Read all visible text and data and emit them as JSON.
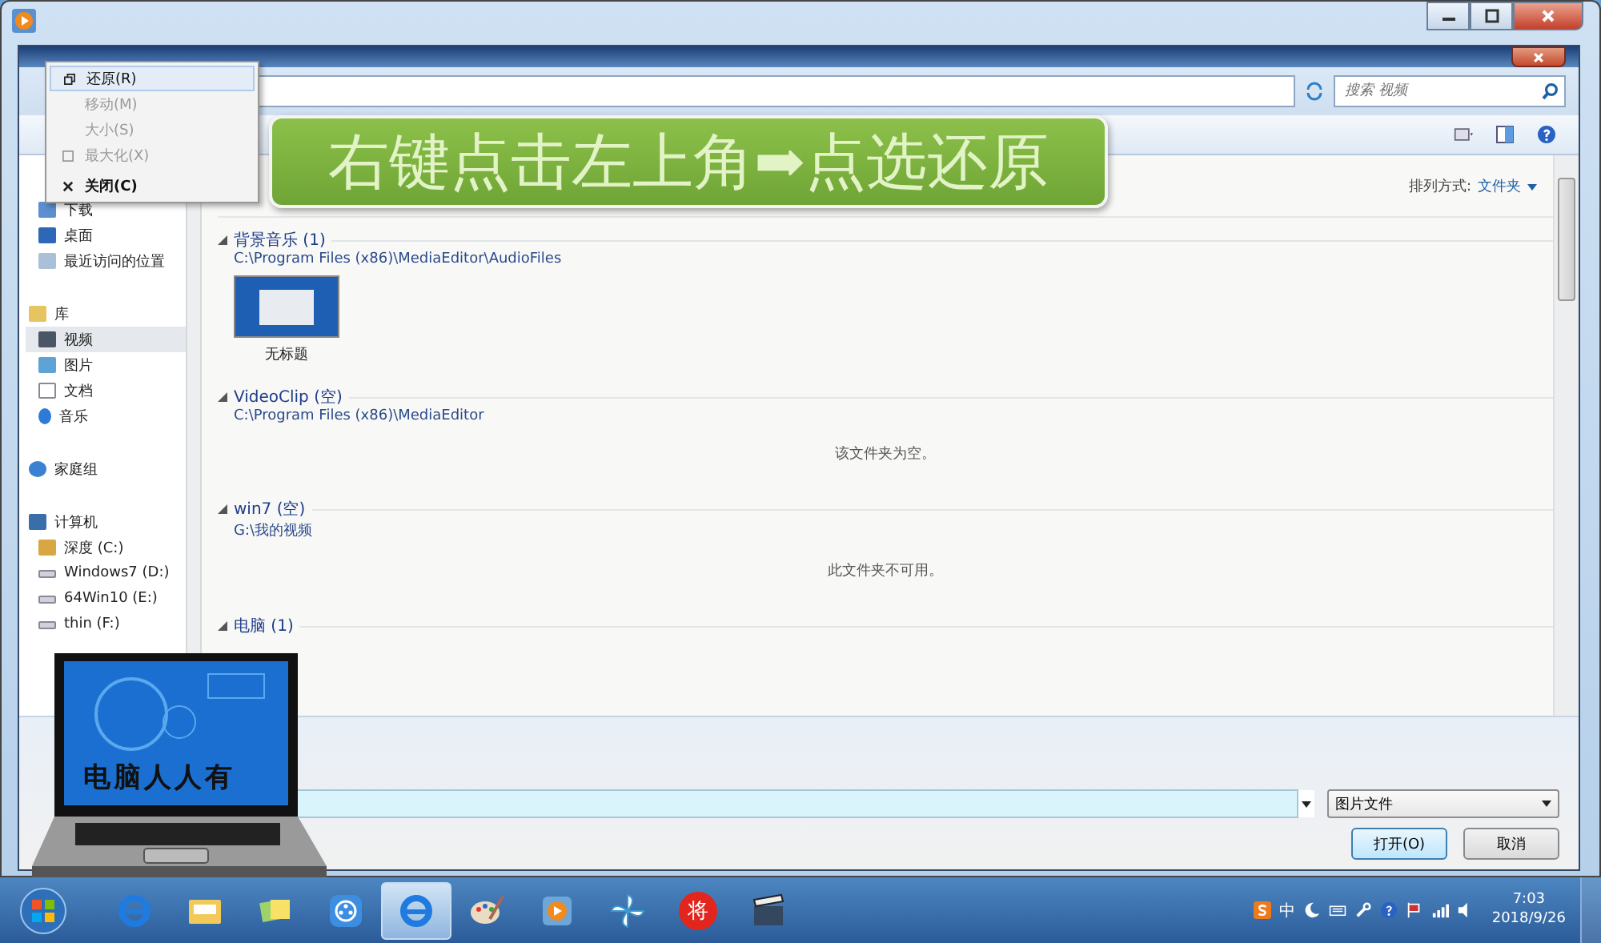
{
  "context_menu": {
    "items": [
      {
        "label": "还原(R)",
        "disabled": false,
        "selected": true,
        "bold": false,
        "kind": "restore"
      },
      {
        "label": "移动(M)",
        "disabled": true,
        "selected": false,
        "bold": false,
        "kind": "none"
      },
      {
        "label": "大小(S)",
        "disabled": true,
        "selected": false,
        "bold": false,
        "kind": "none"
      },
      {
        "label": "最大化(X)",
        "disabled": true,
        "selected": false,
        "bold": false,
        "kind": "maximize"
      },
      {
        "label": "关闭(C)",
        "disabled": false,
        "selected": false,
        "bold": true,
        "kind": "close"
      }
    ]
  },
  "callout": {
    "text": "右键点击左上角➡点选还原"
  },
  "search": {
    "placeholder": "搜索 视频"
  },
  "sort": {
    "label": "排列方式:",
    "value": "文件夹"
  },
  "sidebar": {
    "items": [
      {
        "label": "下载",
        "kind": "download",
        "selected": false
      },
      {
        "label": "桌面",
        "kind": "desktop",
        "selected": false
      },
      {
        "label": "最近访问的位置",
        "kind": "recent",
        "selected": false
      },
      {
        "label": "库",
        "kind": "library",
        "selected": false,
        "children": [
          {
            "label": "视频",
            "kind": "video",
            "selected": true
          },
          {
            "label": "图片",
            "kind": "picture",
            "selected": false
          },
          {
            "label": "文档",
            "kind": "document",
            "selected": false
          },
          {
            "label": "音乐",
            "kind": "music",
            "selected": false
          }
        ]
      },
      {
        "label": "家庭组",
        "kind": "homegroup",
        "selected": false
      },
      {
        "label": "计算机",
        "kind": "computer",
        "selected": false,
        "children": [
          {
            "label": "深度 (C:)",
            "kind": "system-drive",
            "selected": false
          },
          {
            "label": "Windows7 (D:)",
            "kind": "drive",
            "selected": false
          },
          {
            "label": "64Win10 (E:)",
            "kind": "drive",
            "selected": false
          },
          {
            "label": "thin (F:)",
            "kind": "drive",
            "selected": false
          }
        ]
      }
    ]
  },
  "groups": [
    {
      "title": "背景音乐 (1)",
      "path": "C:\\Program Files (x86)\\MediaEditor\\AudioFiles",
      "files": [
        {
          "name": "无标题"
        }
      ]
    },
    {
      "title": "VideoClip (空)",
      "path": "C:\\Program Files (x86)\\MediaEditor",
      "message": "该文件夹为空。"
    },
    {
      "title": "win7 (空)",
      "path": "G:\\我的视频",
      "message": "此文件夹不可用。"
    },
    {
      "title": "电脑 (1)"
    }
  ],
  "file_type": {
    "value": "图片文件"
  },
  "buttons": [
    "打开(O)",
    "取消"
  ],
  "logo": {
    "text": "电脑人人有"
  },
  "taskbar": {
    "apps": [
      {
        "kind": "ie",
        "selected": false
      },
      {
        "kind": "folder",
        "selected": false
      },
      {
        "kind": "notes",
        "selected": false
      },
      {
        "kind": "media",
        "selected": false
      },
      {
        "kind": "ie",
        "selected": true
      },
      {
        "kind": "paint",
        "selected": false
      },
      {
        "kind": "player",
        "selected": false
      },
      {
        "kind": "pinwheel",
        "selected": false
      },
      {
        "kind": "chess",
        "selected": false,
        "glyph": "将"
      },
      {
        "kind": "clapper",
        "selected": false
      }
    ],
    "ime": "中",
    "time": "7:03",
    "date": "2018/9/26"
  }
}
